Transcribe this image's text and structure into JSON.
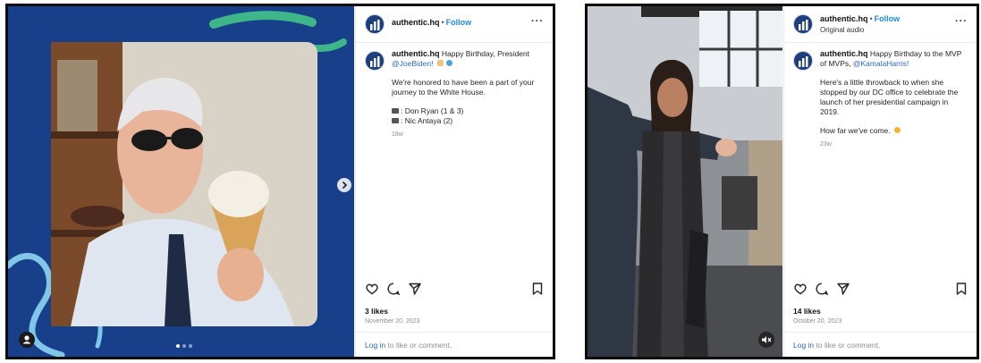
{
  "posts": [
    {
      "username": "authentic.hq",
      "follow_label": "Follow",
      "more_label": "···",
      "caption": {
        "intro": "Happy Birthday, President",
        "mention": "@JoeBiden!",
        "paragraph2": "We're honored to have been a part of your journey to the White House.",
        "credit1": ": Don Ryan (1 & 3)",
        "credit2": ": Nic Antaya (2)",
        "ago": "18w"
      },
      "likes": "3 likes",
      "date": "November 20, 2023",
      "login_link": "Log in",
      "login_rest": " to like or comment.",
      "carousel": {
        "current": 1,
        "total": 3
      },
      "next_icon": "chevron-right-icon",
      "user_tag_icon": "user-tag-icon"
    },
    {
      "username": "authentic.hq",
      "follow_label": "Follow",
      "more_label": "···",
      "audio_label": "Original audio",
      "caption": {
        "intro": "Happy Birthday to the MVP of MVPs,",
        "mention": "@KamalaHarris!",
        "paragraph2": "Here's a little throwback to when she stopped by our DC office to celebrate the launch of her presidential campaign in 2019.",
        "paragraph3": "How far we've come.",
        "ago": "23w"
      },
      "likes": "14 likes",
      "date": "October 20, 2023",
      "login_link": "Log in",
      "login_rest": " to like or comment.",
      "mute_icon": "speaker-muted-icon"
    }
  ],
  "colors": {
    "brand": "#1d3f7d",
    "link": "#2c67c6",
    "follow": "#1d8ce6",
    "muted": "#8e8e8e"
  }
}
